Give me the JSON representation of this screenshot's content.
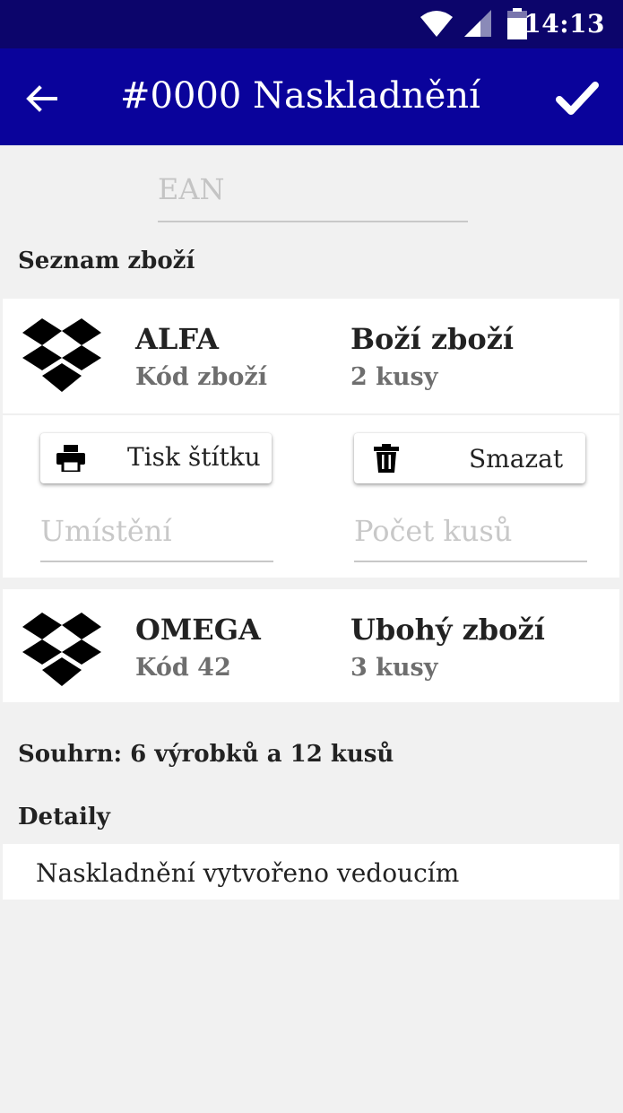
{
  "status_bar": {
    "time": "14:13",
    "icons": [
      "wifi-icon",
      "signal-icon",
      "battery-icon"
    ],
    "background": "#0c056b"
  },
  "app_bar": {
    "title": "#0000 Naskladnění",
    "back_icon": "back-arrow-icon",
    "confirm_icon": "check-icon",
    "background": "#0a039b"
  },
  "ean": {
    "placeholder": "EAN"
  },
  "product_list": {
    "label": "Seznam zboží",
    "items": [
      {
        "name": "ALFA",
        "code": "Kód zboží",
        "description": "Boží zboží",
        "quantity": "2 kusy",
        "icon": "box-icon",
        "expanded": true,
        "actions": {
          "print_label": "Tisk štítku",
          "print_icon": "printer-icon",
          "delete_label": "Smazat",
          "delete_icon": "trash-icon"
        },
        "fields": {
          "location_placeholder": "Umístění",
          "count_placeholder": "Počet kusů"
        }
      },
      {
        "name": "OMEGA",
        "code": "Kód 42",
        "description": "Ubohý zboží",
        "quantity": "3 kusy",
        "icon": "box-icon",
        "expanded": false
      }
    ]
  },
  "summary": "Souhrn: 6 výrobků a 12 kusů",
  "details": {
    "label": "Detaily",
    "text": "Naskladnění vytvořeno vedoucím"
  }
}
